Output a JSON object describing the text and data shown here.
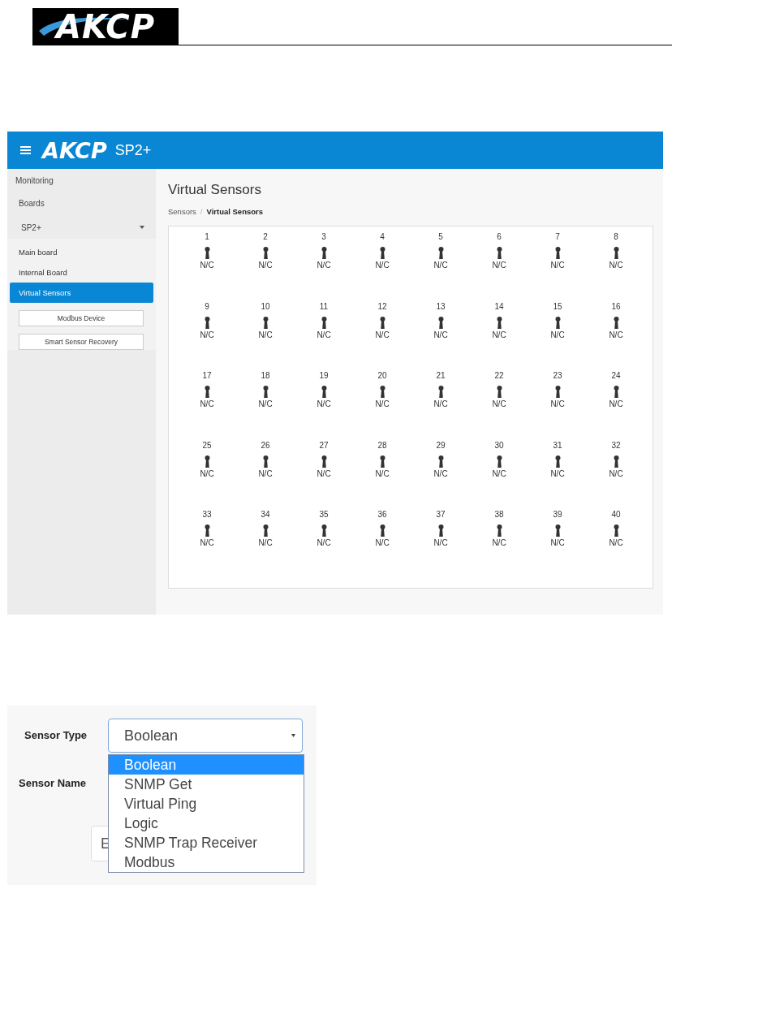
{
  "document_header": {
    "logo": "AKCP"
  },
  "app": {
    "topbar": {
      "logo": "AKCP",
      "product": "SP2+"
    },
    "sidebar": {
      "section": "Monitoring",
      "boards": "Boards",
      "device": {
        "label": "SP2+",
        "expanded": true
      },
      "items": [
        {
          "label": "Main board",
          "selected": false
        },
        {
          "label": "Internal Board",
          "selected": false
        },
        {
          "label": "Virtual Sensors",
          "selected": true
        }
      ],
      "buttons": [
        "Modbus Device",
        "Smart Sensor Recovery"
      ]
    },
    "page_title": "Virtual Sensors",
    "breadcrumb_separator": "/",
    "breadcrumb": [
      {
        "label": "Sensors",
        "current": false
      },
      {
        "label": "Virtual Sensors",
        "current": true
      }
    ],
    "sensors": [
      {
        "number": "1",
        "status": "N/C"
      },
      {
        "number": "2",
        "status": "N/C"
      },
      {
        "number": "3",
        "status": "N/C"
      },
      {
        "number": "4",
        "status": "N/C"
      },
      {
        "number": "5",
        "status": "N/C"
      },
      {
        "number": "6",
        "status": "N/C"
      },
      {
        "number": "7",
        "status": "N/C"
      },
      {
        "number": "8",
        "status": "N/C"
      },
      {
        "number": "9",
        "status": "N/C"
      },
      {
        "number": "10",
        "status": "N/C"
      },
      {
        "number": "11",
        "status": "N/C"
      },
      {
        "number": "12",
        "status": "N/C"
      },
      {
        "number": "13",
        "status": "N/C"
      },
      {
        "number": "14",
        "status": "N/C"
      },
      {
        "number": "15",
        "status": "N/C"
      },
      {
        "number": "16",
        "status": "N/C"
      },
      {
        "number": "17",
        "status": "N/C"
      },
      {
        "number": "18",
        "status": "N/C"
      },
      {
        "number": "19",
        "status": "N/C"
      },
      {
        "number": "20",
        "status": "N/C"
      },
      {
        "number": "21",
        "status": "N/C"
      },
      {
        "number": "22",
        "status": "N/C"
      },
      {
        "number": "23",
        "status": "N/C"
      },
      {
        "number": "24",
        "status": "N/C"
      },
      {
        "number": "25",
        "status": "N/C"
      },
      {
        "number": "26",
        "status": "N/C"
      },
      {
        "number": "27",
        "status": "N/C"
      },
      {
        "number": "28",
        "status": "N/C"
      },
      {
        "number": "29",
        "status": "N/C"
      },
      {
        "number": "30",
        "status": "N/C"
      },
      {
        "number": "31",
        "status": "N/C"
      },
      {
        "number": "32",
        "status": "N/C"
      },
      {
        "number": "33",
        "status": "N/C"
      },
      {
        "number": "34",
        "status": "N/C"
      },
      {
        "number": "35",
        "status": "N/C"
      },
      {
        "number": "36",
        "status": "N/C"
      },
      {
        "number": "37",
        "status": "N/C"
      },
      {
        "number": "38",
        "status": "N/C"
      },
      {
        "number": "39",
        "status": "N/C"
      },
      {
        "number": "40",
        "status": "N/C"
      }
    ]
  },
  "form": {
    "sensor_type_label": "Sensor Type",
    "sensor_type_value": "Boolean",
    "sensor_name_label": "Sensor Name",
    "partial_button": "E",
    "options": [
      {
        "label": "Boolean",
        "selected": true
      },
      {
        "label": "SNMP Get",
        "selected": false
      },
      {
        "label": "Virtual Ping",
        "selected": false
      },
      {
        "label": "Logic",
        "selected": false
      },
      {
        "label": "SNMP Trap Receiver",
        "selected": false
      },
      {
        "label": "Modbus",
        "selected": false
      }
    ]
  }
}
